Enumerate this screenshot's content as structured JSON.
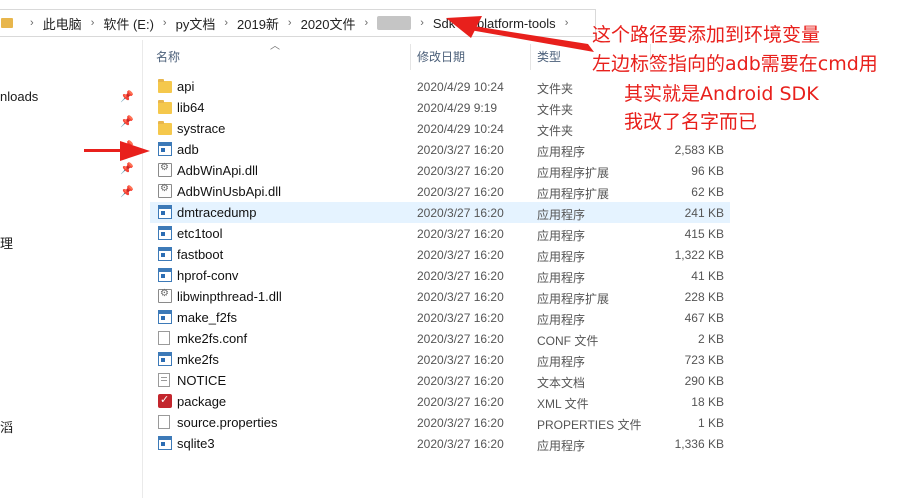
{
  "address_bar": {
    "crumbs": [
      "此电脑",
      "软件 (E:)",
      "py文档",
      "2019新",
      "2020文件",
      "",
      "Sdk",
      "platform-tools"
    ]
  },
  "nav": {
    "items": [
      {
        "label": "nloads",
        "pinned": true
      },
      {
        "label": "",
        "pinned": true
      },
      {
        "label": "",
        "pinned": true
      },
      {
        "label": "",
        "pinned": true
      },
      {
        "label": "",
        "pinned": true
      },
      {
        "label": "理",
        "pinned": false
      },
      {
        "label": "滔",
        "pinned": false
      }
    ]
  },
  "columns": {
    "name": "名称",
    "date": "修改日期",
    "type": "类型",
    "size": ""
  },
  "files": [
    {
      "name": "api",
      "date": "2020/4/29 10:24",
      "type": "文件夹",
      "size": "",
      "icon": "folder-icon"
    },
    {
      "name": "lib64",
      "date": "2020/4/29 9:19",
      "type": "文件夹",
      "size": "",
      "icon": "folder-icon"
    },
    {
      "name": "systrace",
      "date": "2020/4/29 10:24",
      "type": "文件夹",
      "size": "",
      "icon": "folder-icon"
    },
    {
      "name": "adb",
      "date": "2020/3/27 16:20",
      "type": "应用程序",
      "size": "2,583 KB",
      "icon": "exe-icon"
    },
    {
      "name": "AdbWinApi.dll",
      "date": "2020/3/27 16:20",
      "type": "应用程序扩展",
      "size": "96 KB",
      "icon": "dll-icon"
    },
    {
      "name": "AdbWinUsbApi.dll",
      "date": "2020/3/27 16:20",
      "type": "应用程序扩展",
      "size": "62 KB",
      "icon": "dll-icon"
    },
    {
      "name": "dmtracedump",
      "date": "2020/3/27 16:20",
      "type": "应用程序",
      "size": "241 KB",
      "icon": "exe-icon"
    },
    {
      "name": "etc1tool",
      "date": "2020/3/27 16:20",
      "type": "应用程序",
      "size": "415 KB",
      "icon": "exe-icon"
    },
    {
      "name": "fastboot",
      "date": "2020/3/27 16:20",
      "type": "应用程序",
      "size": "1,322 KB",
      "icon": "exe-icon"
    },
    {
      "name": "hprof-conv",
      "date": "2020/3/27 16:20",
      "type": "应用程序",
      "size": "41 KB",
      "icon": "exe-icon"
    },
    {
      "name": "libwinpthread-1.dll",
      "date": "2020/3/27 16:20",
      "type": "应用程序扩展",
      "size": "228 KB",
      "icon": "dll-icon"
    },
    {
      "name": "make_f2fs",
      "date": "2020/3/27 16:20",
      "type": "应用程序",
      "size": "467 KB",
      "icon": "exe-icon"
    },
    {
      "name": "mke2fs.conf",
      "date": "2020/3/27 16:20",
      "type": "CONF 文件",
      "size": "2 KB",
      "icon": "document-icon"
    },
    {
      "name": "mke2fs",
      "date": "2020/3/27 16:20",
      "type": "应用程序",
      "size": "723 KB",
      "icon": "exe-icon"
    },
    {
      "name": "NOTICE",
      "date": "2020/3/27 16:20",
      "type": "文本文档",
      "size": "290 KB",
      "icon": "text-file-icon"
    },
    {
      "name": "package",
      "date": "2020/3/27 16:20",
      "type": "XML 文件",
      "size": "18 KB",
      "icon": "xml-icon"
    },
    {
      "name": "source.properties",
      "date": "2020/3/27 16:20",
      "type": "PROPERTIES 文件",
      "size": "1 KB",
      "icon": "document-icon"
    },
    {
      "name": "sqlite3",
      "date": "2020/3/27 16:20",
      "type": "应用程序",
      "size": "1,336 KB",
      "icon": "exe-icon"
    }
  ],
  "selected_row": 6,
  "annotations": {
    "lines": [
      "这个路径要添加到环境变量",
      "左边标签指向的adb需要在cmd用",
      "其实就是Android SDK",
      "我改了名字而已"
    ],
    "color": "#e8201c"
  },
  "colors": {
    "selection": "#e5f3ff",
    "header_text": "#4c607a",
    "folder": "#f5c84c"
  }
}
